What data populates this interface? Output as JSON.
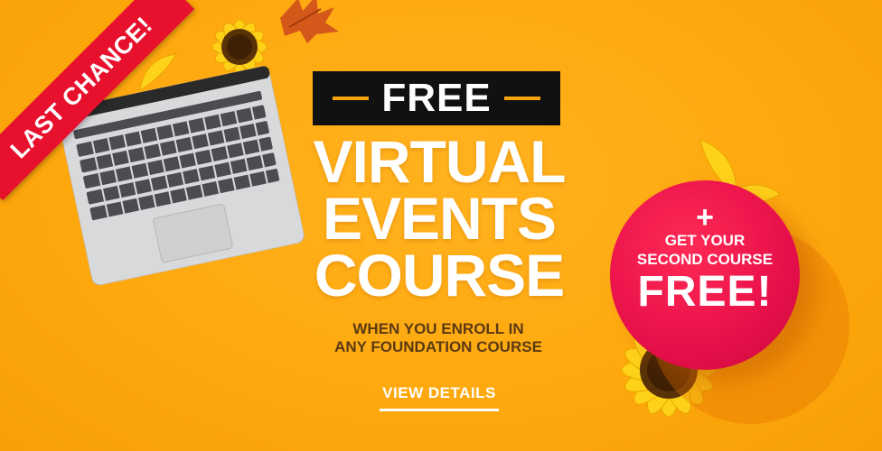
{
  "ribbon": {
    "label": "LAST CHANCE!"
  },
  "promo": {
    "tag": "FREE",
    "title_lines": [
      "VIRTUAL",
      "EVENTS",
      "COURSE"
    ],
    "subtitle_lines": [
      "WHEN YOU ENROLL IN",
      "ANY FOUNDATION COURSE"
    ],
    "cta": "VIEW DETAILS"
  },
  "badge": {
    "plus": "+",
    "lines": [
      "GET YOUR",
      "SECOND COURSE"
    ],
    "free": "FREE!"
  },
  "colors": {
    "background": "#ffa90f",
    "ribbon": "#e8112d",
    "badge": "#e8104a",
    "tag_bg": "#111111"
  },
  "icons": [
    "laptop-image",
    "sunflower-image",
    "autumn-leaf-image"
  ]
}
